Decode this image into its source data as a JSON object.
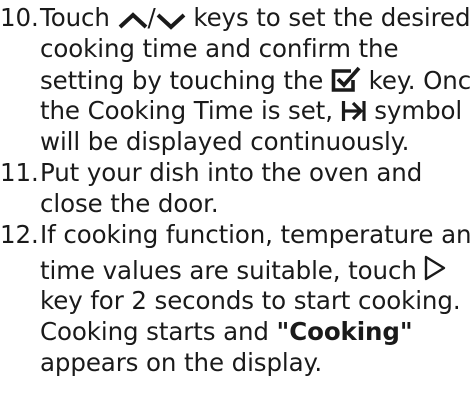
{
  "steps": [
    {
      "number": "10.",
      "lines": [
        {
          "a": "Touch ",
          "sep": "/",
          "b": " keys to set the desired"
        },
        {
          "text": "cooking time and confirm the"
        },
        {
          "a": "setting by touching the ",
          "b": " key. Once"
        },
        {
          "a": "the Cooking Time is set, ",
          "b": " symbol"
        },
        {
          "text": "will be displayed continuously."
        }
      ]
    },
    {
      "number": "11.",
      "lines": [
        {
          "text": "Put your dish into the oven and"
        },
        {
          "text": "close the door."
        }
      ]
    },
    {
      "number": "12.",
      "lines": [
        {
          "text": "If cooking function, temperature and"
        },
        {
          "a": "time values are suitable, touch "
        },
        {
          "text": "key for 2 seconds to start cooking."
        },
        {
          "a": "Cooking starts and ",
          "bold": "\"Cooking\""
        },
        {
          "text": "appears on the display."
        }
      ]
    }
  ],
  "icons": {
    "up": "chevron-up-icon",
    "down": "chevron-down-icon",
    "confirm": "checkbox-confirm-icon",
    "cooking_time": "cooking-time-arrow-bar-icon",
    "start": "play-triangle-icon"
  }
}
